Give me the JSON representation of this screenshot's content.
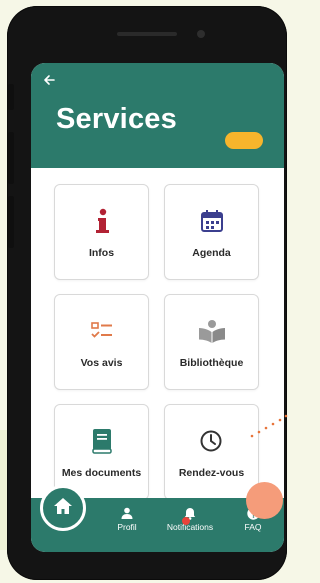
{
  "header": {
    "back_icon": "arrow-left-icon",
    "title": "Services",
    "accent_color": "#f7b52c",
    "background_color": "#2c7a6b"
  },
  "services": [
    {
      "label": "Infos",
      "icon": "info-icon",
      "color": "#b22234"
    },
    {
      "label": "Agenda",
      "icon": "calendar-icon",
      "color": "#3b3f8f"
    },
    {
      "label": "Vos avis",
      "icon": "checklist-icon",
      "color": "#e07a4a"
    },
    {
      "label": "Bibliothèque",
      "icon": "reader-icon",
      "color": "#9a9a9a"
    },
    {
      "label": "Mes documents",
      "icon": "book-icon",
      "color": "#2c7a6b"
    },
    {
      "label": "Rendez-vous",
      "icon": "clock-icon",
      "color": "#333333"
    }
  ],
  "bottom_nav": {
    "home_icon": "home-icon",
    "items": [
      {
        "label": "Profil",
        "icon": "person-icon"
      },
      {
        "label": "Notifications",
        "icon": "bell-icon"
      },
      {
        "label": "FAQ",
        "icon": "help-circle-icon"
      }
    ]
  }
}
